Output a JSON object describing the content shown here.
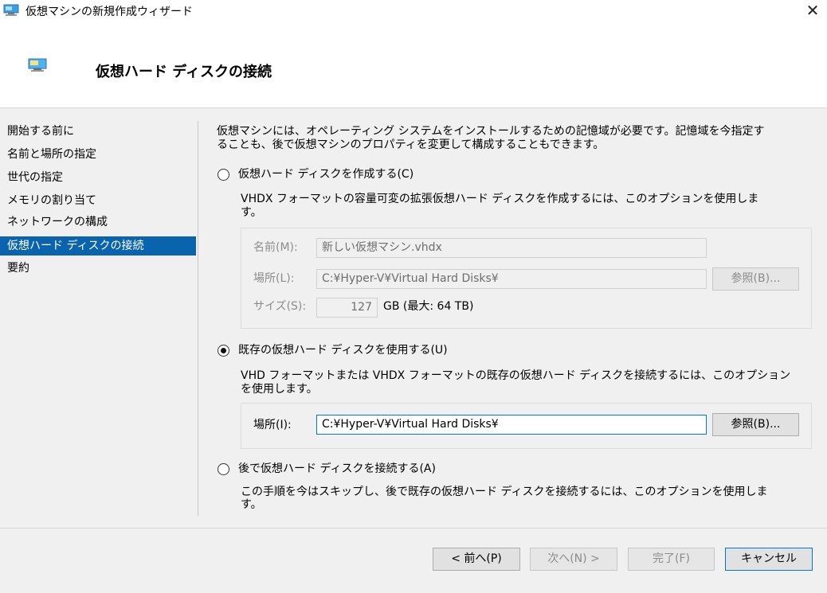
{
  "window": {
    "title": "仮想マシンの新規作成ウィザード",
    "close_glyph": "✕"
  },
  "header": {
    "title": "仮想ハード ディスクの接続"
  },
  "nav": {
    "items": [
      {
        "label": "開始する前に"
      },
      {
        "label": "名前と場所の指定"
      },
      {
        "label": "世代の指定"
      },
      {
        "label": "メモリの割り当て"
      },
      {
        "label": "ネットワークの構成"
      },
      {
        "label": "仮想ハード ディスクの接続",
        "active": true
      },
      {
        "label": "要約"
      }
    ]
  },
  "content": {
    "intro_line1": "仮想マシンには、オペレーティング システムをインストールするための記憶域が必要です。記憶域を今指定す",
    "intro_line2": "ることも、後で仮想マシンのプロパティを変更して構成することもできます。",
    "create": {
      "label": "仮想ハード ディスクを作成する(C)",
      "selected": false,
      "desc_line1": "VHDX フォーマットの容量可変の拡張仮想ハード ディスクを作成するには、このオプションを使用しま",
      "desc_line2": "す。",
      "name_label": "名前(M):",
      "name_value": "新しい仮想マシン.vhdx",
      "location_label": "場所(L):",
      "location_value": "C:¥Hyper-V¥Virtual Hard Disks¥",
      "browse_label": "参照(B)...",
      "size_label": "サイズ(S):",
      "size_value": "127",
      "size_unit": "GB (最大: 64 TB)"
    },
    "existing": {
      "label": "既存の仮想ハード ディスクを使用する(U)",
      "selected": true,
      "desc_line1": "VHD フォーマットまたは VHDX フォーマットの既存の仮想ハード ディスクを接続するには、このオプション",
      "desc_line2": "を使用します。",
      "location_label": "場所(I):",
      "location_value": "C:¥Hyper-V¥Virtual Hard Disks¥",
      "browse_label": "参照(B)..."
    },
    "later": {
      "label": "後で仮想ハード ディスクを接続する(A)",
      "selected": false,
      "desc_line1": "この手順を今はスキップし、後で既存の仮想ハード ディスクを接続するには、このオプションを使用しま",
      "desc_line2": "す。"
    }
  },
  "footer": {
    "prev_label": "< 前へ(P)",
    "next_label": "次へ(N) >",
    "finish_label": "完了(F)",
    "cancel_label": "キャンセル"
  },
  "colors": {
    "accent": "#0a64ad",
    "focus": "#0078d7",
    "panel": "#f0f0f0"
  }
}
